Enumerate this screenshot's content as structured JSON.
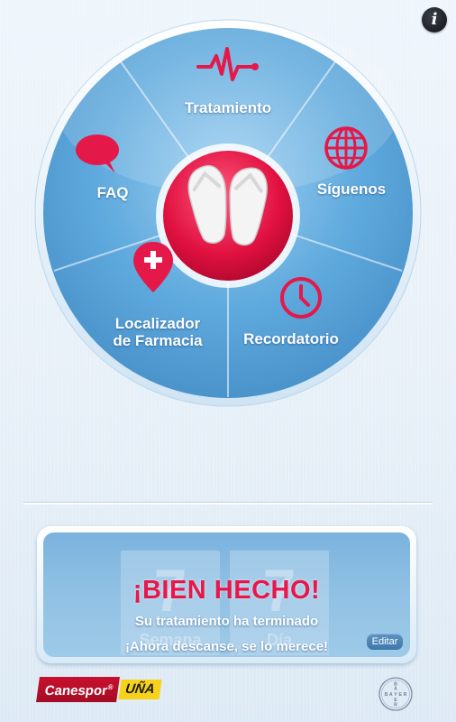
{
  "app": {
    "info_icon": "info-icon",
    "info_glyph": "i"
  },
  "menu": {
    "center_icon": "flip-flops-icon",
    "items": [
      {
        "id": "tratamiento",
        "label": "Tratamiento",
        "icon": "heartbeat-icon"
      },
      {
        "id": "faq",
        "label": "FAQ",
        "icon": "speech-bubble-icon"
      },
      {
        "id": "siguenos",
        "label": "Síguenos",
        "icon": "globe-icon"
      },
      {
        "id": "localizador",
        "label_line1": "Localizador",
        "label_line2": "de Farmacia",
        "icon": "map-pin-plus-icon"
      },
      {
        "id": "recordatorio",
        "label": "Recordatorio",
        "icon": "clock-icon"
      }
    ]
  },
  "status_card": {
    "title": "¡BIEN HECHO!",
    "line1": "Su tratamiento ha terminado",
    "line2": "¡Ahora descanse, se lo merece!",
    "edit_label": "Editar",
    "counters": [
      {
        "value": "7",
        "caption": "Semana"
      },
      {
        "value": "7",
        "caption": "Día"
      }
    ]
  },
  "brand": {
    "name": "Canespor",
    "mark": "®",
    "suffix": "UÑA"
  },
  "footer_logo": {
    "name": "BAYER"
  },
  "colors": {
    "accent_red": "#e8174a",
    "wheel_blue": "#5aa5d8",
    "icon_red": "#e5184a"
  }
}
